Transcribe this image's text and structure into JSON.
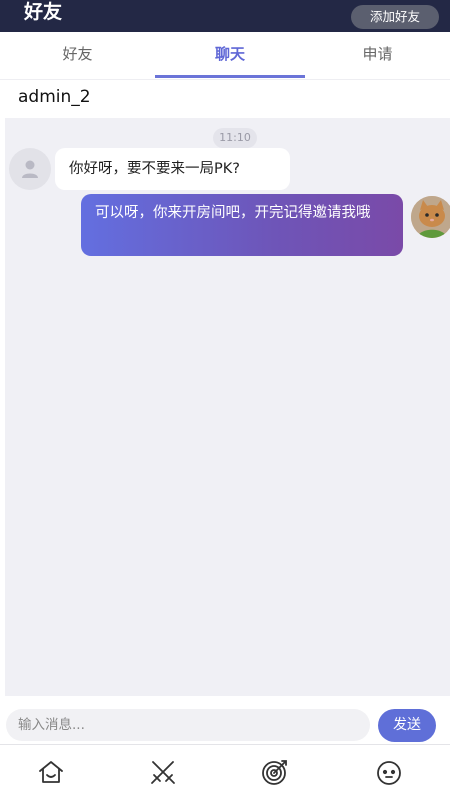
{
  "header": {
    "title": "好友",
    "add_friend_label": "添加好友"
  },
  "tabs": [
    {
      "label": "好友"
    },
    {
      "label": "聊天",
      "active": true
    },
    {
      "label": "申请"
    }
  ],
  "chat": {
    "partner_name": "admin_2",
    "time": "11:10",
    "messages": [
      {
        "side": "left",
        "text": "你好呀，要不要来一局PK?"
      },
      {
        "side": "right",
        "text": "可以呀，你来开房间吧，开完记得邀请我哦"
      }
    ]
  },
  "composer": {
    "placeholder": "输入消息...",
    "send_label": "发送"
  },
  "bottom_nav": [
    {
      "icon": "home-icon"
    },
    {
      "icon": "crossed-swords-icon"
    },
    {
      "icon": "target-icon"
    },
    {
      "icon": "smiley-icon"
    }
  ],
  "colors": {
    "header_bg": "#232845",
    "accent": "#5f67d6",
    "bubble_gradient_start": "#636fe0",
    "bubble_gradient_end": "#7a4aa8"
  }
}
